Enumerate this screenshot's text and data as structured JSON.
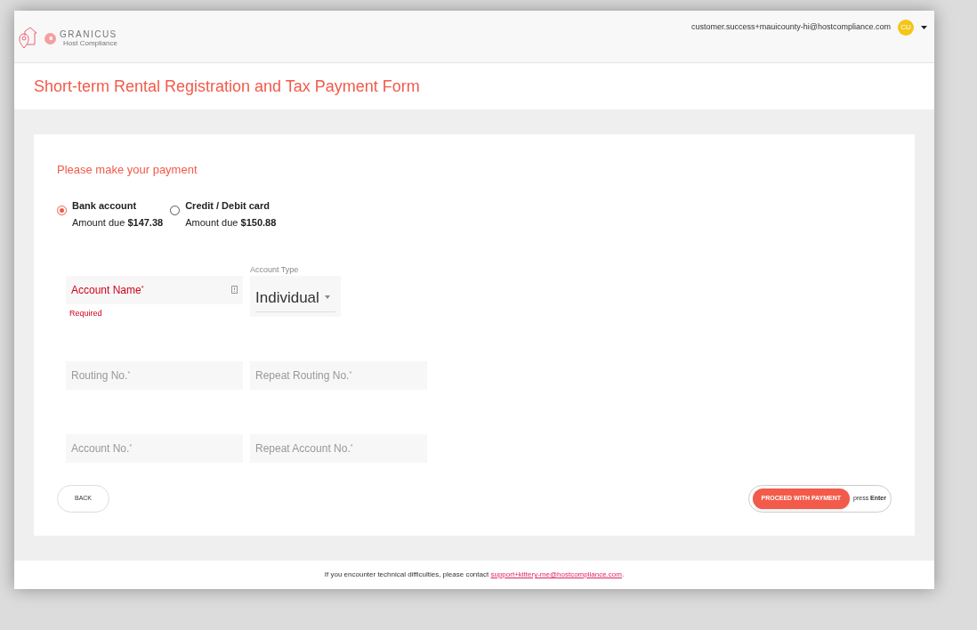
{
  "header": {
    "brand": "GRANICUS",
    "brand_sub": "Host Compliance",
    "user_email": "customer.success+mauicounty-hi@hostcompliance.com",
    "avatar": "CU"
  },
  "page_title": "Short-term Rental Registration and Tax Payment Form",
  "form": {
    "heading": "Please make your payment",
    "payment_options": [
      {
        "label": "Bank account",
        "amount_prefix": "Amount due",
        "amount": "$147.38",
        "selected": true
      },
      {
        "label": "Credit / Debit card",
        "amount_prefix": "Amount due",
        "amount": "$150.88",
        "selected": false
      }
    ],
    "rows": [
      [
        {
          "kind": "text",
          "placeholder": "Account Name",
          "required_mark": "*",
          "error": "Required"
        },
        {
          "kind": "select",
          "label": "Account Type",
          "value": "Individual"
        }
      ],
      [
        {
          "kind": "text",
          "placeholder": "Routing No.",
          "required_mark": "*"
        },
        {
          "kind": "text",
          "placeholder": "Repeat Routing No.",
          "required_mark": "*"
        }
      ],
      [
        {
          "kind": "text",
          "placeholder": "Account No.",
          "required_mark": "*"
        },
        {
          "kind": "text",
          "placeholder": "Repeat Account No.",
          "required_mark": "*"
        }
      ]
    ],
    "back_button": "BACK",
    "proceed_button": "PROCEED WITH PAYMENT",
    "hint_prefix": "press",
    "hint_key": "Enter"
  },
  "footer": {
    "text": "If you encounter technical difficulties, please contact",
    "link": "support+kittery-me@hostcompliance.com",
    "end": "."
  }
}
